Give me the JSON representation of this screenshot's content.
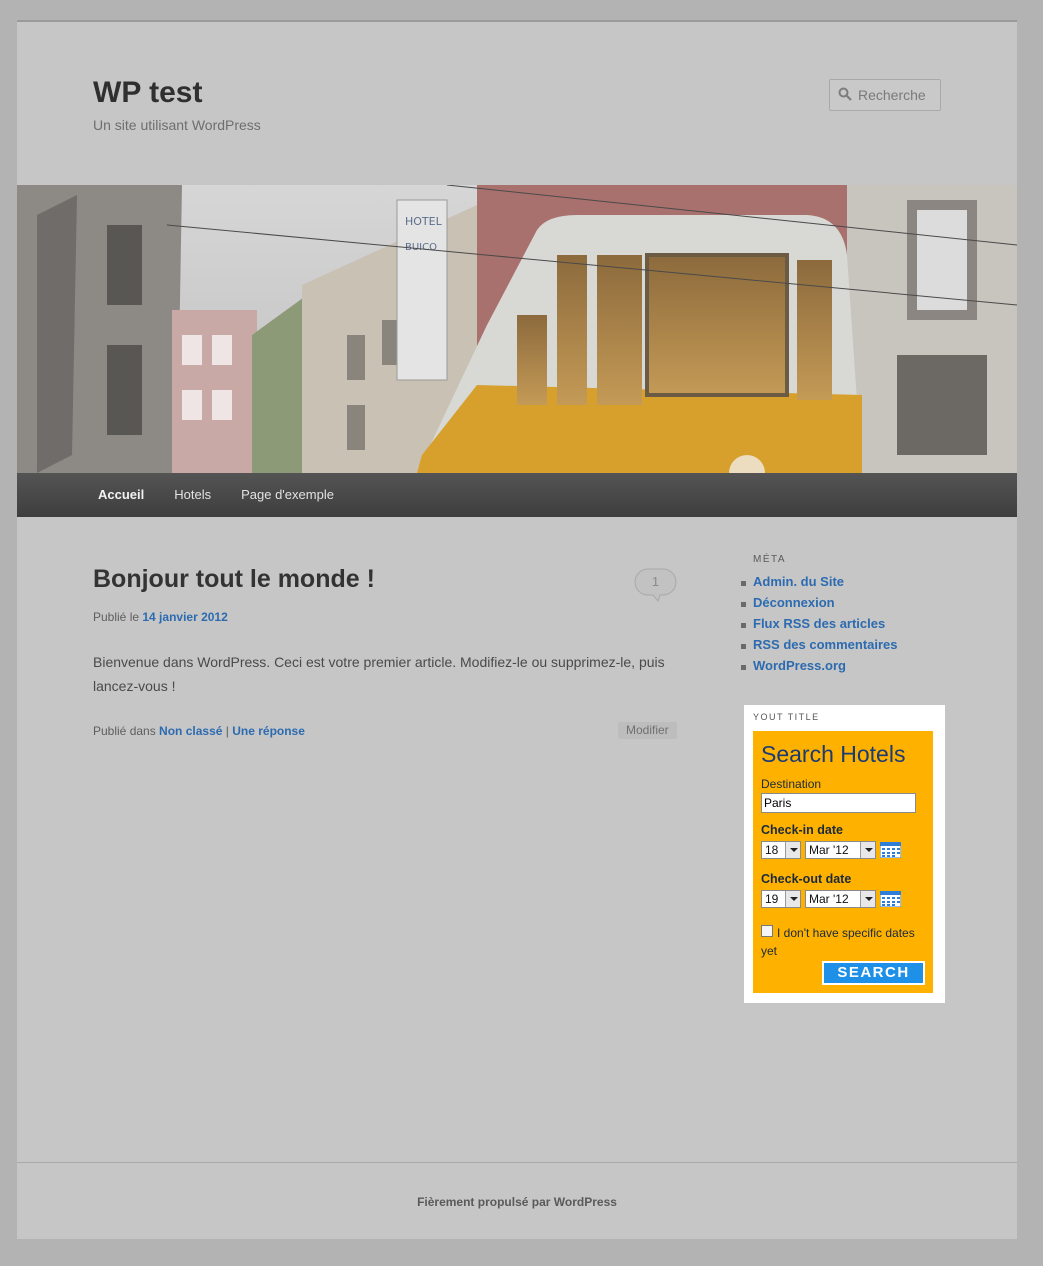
{
  "site": {
    "title": "WP test",
    "description": "Un site utilisant WordPress",
    "search_placeholder": "Recherche"
  },
  "nav": {
    "items": [
      {
        "label": "Accueil",
        "current": true
      },
      {
        "label": "Hotels"
      },
      {
        "label": "Page d'exemple"
      }
    ]
  },
  "post": {
    "title": "Bonjour tout le monde !",
    "comment_count": "1",
    "posted_prefix": "Publié le ",
    "date": "14 janvier 2012",
    "body": "Bienvenue dans WordPress. Ceci est votre premier article. Modifiez-le ou supprimez-le, puis lancez-vous !",
    "category_prefix": "Publié dans ",
    "category": "Non classé",
    "separator": " | ",
    "replies": "Une réponse",
    "edit_label": "Modifier"
  },
  "sidebar": {
    "meta_title": "MÉTA",
    "meta_links": [
      "Admin. du Site",
      "Déconnexion",
      "Flux RSS des articles",
      "RSS des commentaires",
      "WordPress.org"
    ]
  },
  "widget": {
    "title": "YOUT TITLE",
    "heading": "Search Hotels",
    "destination_label": "Destination",
    "destination_value": "Paris",
    "checkin_label": "Check-in date",
    "checkin_day": "18",
    "checkin_month": "Mar '12",
    "checkout_label": "Check-out date",
    "checkout_day": "19",
    "checkout_month": "Mar '12",
    "no_dates_label": "I don't have specific dates yet",
    "search_label": "SEARCH",
    "colors": {
      "box": "#ffb100",
      "button": "#1e90e8"
    }
  },
  "footer": {
    "text": "Fièrement propulsé par WordPress"
  }
}
